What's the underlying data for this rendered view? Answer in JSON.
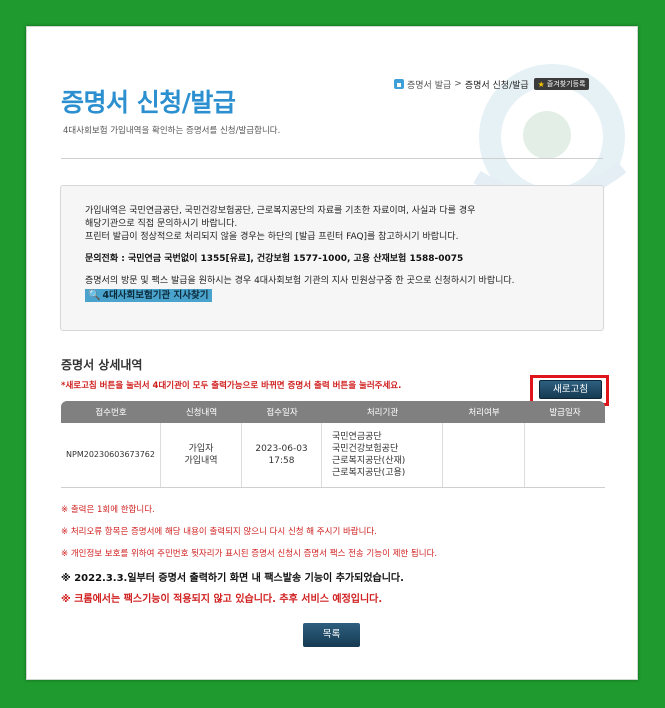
{
  "header": {
    "title": "증명서 신청/발급",
    "subtitle": "4대사회보험 가입내역을 확인하는 증명서를 신청/발급합니다."
  },
  "breadcrumb": {
    "parent": "증명서 발급",
    "separator": ">",
    "current": "증명서 신청/발급",
    "favorite_label": "즐겨찾기등록"
  },
  "notice": {
    "line1": "가입내역은 국민연금공단, 국민건강보험공단, 근로복지공단의 자료를 기초한 자료이며, 사실과 다를 경우",
    "line2": "해당기관으로 직접 문의하시기 바랍니다.",
    "line3": "프린터 발급이 정상적으로 처리되지 않을 경우는 하단의 [발급 프린터 FAQ]를 참고하시기 바랍니다.",
    "phone": "문의전화 : 국민연금 국번없이 1355[유료], 건강보험 1577-1000, 고용 산재보험 1588-0075",
    "visit": "증명서의 방문 및 팩스 발급을 원하시는 경우 4대사회보험 기관의 지사 민원상구중 한 곳으로 신청하시기 바랍니다.",
    "branch_link": "4대사회보험기관 지사찾기"
  },
  "detail": {
    "section_title": "증명서 상세내역",
    "warning": "*새로고침 버튼을 눌러서 4대기관이 모두 출력가능으로 바뀌면 증명서 출력 버튼을 눌러주세요.",
    "refresh_label": "새로고침",
    "columns": [
      "접수번호",
      "신청내역",
      "접수일자",
      "처리기관",
      "처리여부",
      "발급일자"
    ],
    "row": {
      "receipt_no": "NPM2023060367376​2",
      "request_1": "가입자",
      "request_2": "가입내역",
      "date": "2023-06-03",
      "time": "17:58",
      "agency_1": "국민연금공단",
      "agency_2": "국민건강보험공단",
      "agency_3": "근로복지공단(산재)",
      "agency_4": "근로복지공단(고용)",
      "status": "",
      "issue_date": ""
    }
  },
  "notes": {
    "n1": "※ 출력은 1회에 한합니다.",
    "n2": "※ 처리오류 항목은 증명서에 해당 내용이 출력되지 않으니 다시 신청 해 주시기 바랍니다.",
    "n3": "※ 개인정보 보호를 위하여 주민번호 뒷자리가 표시된 증명서 신청시 증명서 팩스 전송 기능이 제한 됩니다.",
    "n4": "※ 2022.3.3.일부터 증명서 출력하기 화면 내 팩스발송 기능이 추가되었습니다.",
    "n5": "※ 크롬에서는 팩스기능이 적용되지 않고 있습니다. 추후 서비스 예정입니다."
  },
  "footer": {
    "list_label": "목록"
  },
  "colors": {
    "background": "#1e9a2e",
    "title": "#2c8fcf",
    "warning": "#d02020",
    "highlight": "#e0141b",
    "button": "#1f4a66"
  }
}
